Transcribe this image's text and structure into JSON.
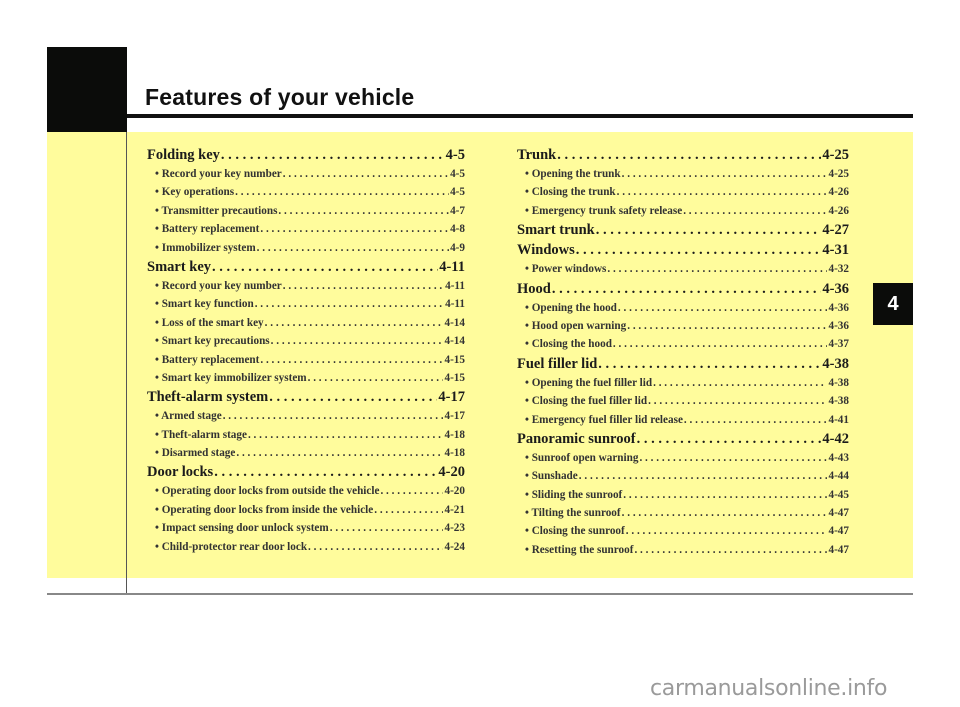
{
  "header": {
    "title": "Features of your vehicle",
    "chapter_tab": "4"
  },
  "colors": {
    "band_yellow": "#fffc9c",
    "block_black": "#0b0c0a"
  },
  "toc": {
    "left": [
      {
        "type": "main",
        "label": "Folding key",
        "page": "4-5"
      },
      {
        "type": "sub",
        "label": "• Record your key number",
        "page": "4-5"
      },
      {
        "type": "sub",
        "label": "• Key operations",
        "page": "4-5"
      },
      {
        "type": "sub",
        "label": "• Transmitter precautions",
        "page": "4-7"
      },
      {
        "type": "sub",
        "label": "• Battery replacement",
        "page": "4-8"
      },
      {
        "type": "sub",
        "label": "• Immobilizer system",
        "page": "4-9"
      },
      {
        "type": "main",
        "label": "Smart key",
        "page": "4-11"
      },
      {
        "type": "sub",
        "label": "• Record your key number",
        "page": "4-11"
      },
      {
        "type": "sub",
        "label": "• Smart key function",
        "page": "4-11"
      },
      {
        "type": "sub",
        "label": "• Loss of the smart key",
        "page": "4-14"
      },
      {
        "type": "sub",
        "label": "• Smart key precautions",
        "page": "4-14"
      },
      {
        "type": "sub",
        "label": "• Battery replacement",
        "page": "4-15"
      },
      {
        "type": "sub",
        "label": "• Smart key immobilizer system",
        "page": "4-15"
      },
      {
        "type": "main",
        "label": "Theft-alarm system",
        "page": "4-17"
      },
      {
        "type": "sub",
        "label": "• Armed stage",
        "page": "4-17"
      },
      {
        "type": "sub",
        "label": "• Theft-alarm stage",
        "page": "4-18"
      },
      {
        "type": "sub",
        "label": "• Disarmed stage",
        "page": "4-18"
      },
      {
        "type": "main",
        "label": "Door locks",
        "page": "4-20"
      },
      {
        "type": "sub",
        "label": "• Operating door locks from outside the vehicle",
        "page": "4-20"
      },
      {
        "type": "sub",
        "label": "• Operating door locks from inside the vehicle",
        "page": "4-21"
      },
      {
        "type": "sub",
        "label": "• Impact sensing door unlock system",
        "page": "4-23"
      },
      {
        "type": "sub",
        "label": "• Child-protector rear door lock",
        "page": "4-24"
      }
    ],
    "right": [
      {
        "type": "main",
        "label": "Trunk",
        "page": "4-25"
      },
      {
        "type": "sub",
        "label": "• Opening the trunk",
        "page": "4-25"
      },
      {
        "type": "sub",
        "label": "• Closing the trunk",
        "page": "4-26"
      },
      {
        "type": "sub",
        "label": "• Emergency trunk safety release",
        "page": "4-26"
      },
      {
        "type": "main",
        "label": "Smart trunk",
        "page": "4-27"
      },
      {
        "type": "main",
        "label": "Windows",
        "page": "4-31"
      },
      {
        "type": "sub",
        "label": "• Power windows",
        "page": "4-32"
      },
      {
        "type": "main",
        "label": "Hood",
        "page": "4-36"
      },
      {
        "type": "sub",
        "label": "• Opening the hood",
        "page": "4-36"
      },
      {
        "type": "sub",
        "label": "• Hood open warning",
        "page": "4-36"
      },
      {
        "type": "sub",
        "label": "• Closing the hood",
        "page": "4-37"
      },
      {
        "type": "main",
        "label": "Fuel filler lid",
        "page": "4-38"
      },
      {
        "type": "sub",
        "label": "• Opening the fuel filler lid",
        "page": "4-38"
      },
      {
        "type": "sub",
        "label": "• Closing the fuel filler lid",
        "page": "4-38"
      },
      {
        "type": "sub",
        "label": "• Emergency fuel filler lid release",
        "page": "4-41"
      },
      {
        "type": "main",
        "label": "Panoramic sunroof",
        "page": "4-42"
      },
      {
        "type": "sub",
        "label": "• Sunroof open warning",
        "page": "4-43"
      },
      {
        "type": "sub",
        "label": "• Sunshade",
        "page": "4-44"
      },
      {
        "type": "sub",
        "label": "• Sliding the sunroof",
        "page": "4-45"
      },
      {
        "type": "sub",
        "label": "• Tilting the sunroof",
        "page": "4-47"
      },
      {
        "type": "sub",
        "label": "• Closing the sunroof",
        "page": "4-47"
      },
      {
        "type": "sub",
        "label": "• Resetting the sunroof",
        "page": "4-47"
      }
    ]
  },
  "watermark": "carmanualsonline.info"
}
